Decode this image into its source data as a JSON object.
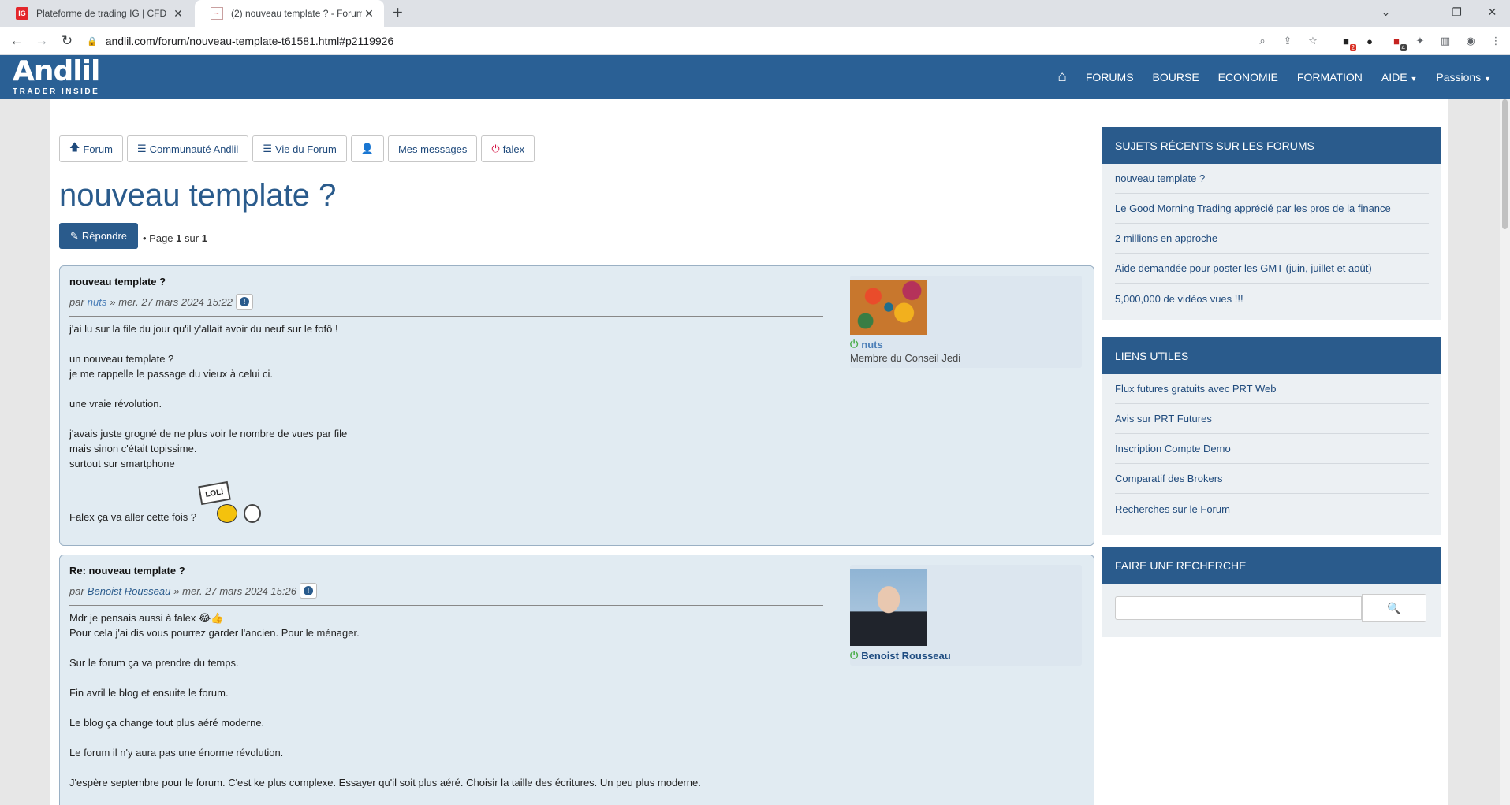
{
  "browser": {
    "tabs": [
      {
        "title": "Plateforme de trading IG | CFD",
        "favicon": "ig-logo-icon"
      },
      {
        "title": "(2) nouveau template ? - Forum",
        "favicon": "chart-icon"
      }
    ],
    "url": "andlil.com/forum/nouveau-template-t61581.html#p2119926",
    "extension_badges": [
      "2",
      "4"
    ]
  },
  "site": {
    "logo_main": "Andlil",
    "logo_sub": "TRADER INSIDE",
    "nav": [
      "FORUMS",
      "BOURSE",
      "ECONOMIE",
      "FORMATION",
      "AIDE",
      "Passions"
    ],
    "brand_color": "#2a6095"
  },
  "toolbar": {
    "forum": "Forum",
    "communaute": "Communauté Andlil",
    "vie": "Vie du Forum",
    "messages": "Mes messages",
    "user": "falex"
  },
  "topic": {
    "title": "nouveau template ?",
    "reply_label": "Répondre",
    "page_prefix": "• Page",
    "page_current": "1",
    "page_sep": "sur",
    "page_total": "1"
  },
  "posts": [
    {
      "title": "nouveau template ?",
      "by": "par",
      "author": "nuts",
      "date": "» mer. 27 mars 2024 15:22",
      "lines": [
        "j'ai lu sur la file du jour qu'il y'allait avoir du neuf sur le fofô !",
        "",
        "un nouveau template ?",
        "je me rappelle le passage du vieux à celui ci.",
        "",
        "une vraie révolution.",
        "",
        "j'avais juste grogné de ne plus voir le nombre de vues par file",
        "mais sinon c'était topissime.",
        "surtout sur smartphone"
      ],
      "last_line": "Falex ça va aller cette fois ?",
      "smiley_text": "LOL!",
      "profile_name": "nuts",
      "profile_rank": "Membre du Conseil Jedi"
    },
    {
      "title": "Re: nouveau template ?",
      "by": "par",
      "author": "Benoist Rousseau",
      "date": "» mer. 27 mars 2024 15:26",
      "first_line": "Mdr je pensais aussi à falex",
      "emoji": "😂👍",
      "lines": [
        "Pour cela j'ai dis vous pourrez garder l'ancien. Pour le ménager.",
        "",
        "Sur le forum ça va prendre du temps.",
        "",
        "Fin avril le blog et ensuite le forum.",
        "",
        "Le blog ça change tout plus aéré moderne.",
        "",
        "Le forum il n'y aura pas une énorme révolution.",
        "",
        "J'espère septembre pour le forum. C'est ke plus complexe. Essayer qu'il soit plus aéré. Choisir la taille des écritures. Un peu plus moderne."
      ],
      "profile_name": "Benoist Rousseau"
    }
  ],
  "sidebar": {
    "recent": {
      "title": "SUJETS RÉCENTS SUR LES FORUMS",
      "items": [
        "nouveau template ?",
        "Le Good Morning Trading apprécié par les pros de la finance",
        "2 millions en approche",
        "Aide demandée pour poster les GMT (juin, juillet et août)",
        "5,000,000 de vidéos vues !!!"
      ]
    },
    "links": {
      "title": "LIENS UTILES",
      "items": [
        "Flux futures gratuits avec PRT Web",
        "Avis sur PRT Futures",
        "Inscription Compte Demo",
        "Comparatif des Brokers",
        "Recherches sur le Forum"
      ]
    },
    "search": {
      "title": "FAIRE UNE RECHERCHE",
      "placeholder": ""
    }
  }
}
